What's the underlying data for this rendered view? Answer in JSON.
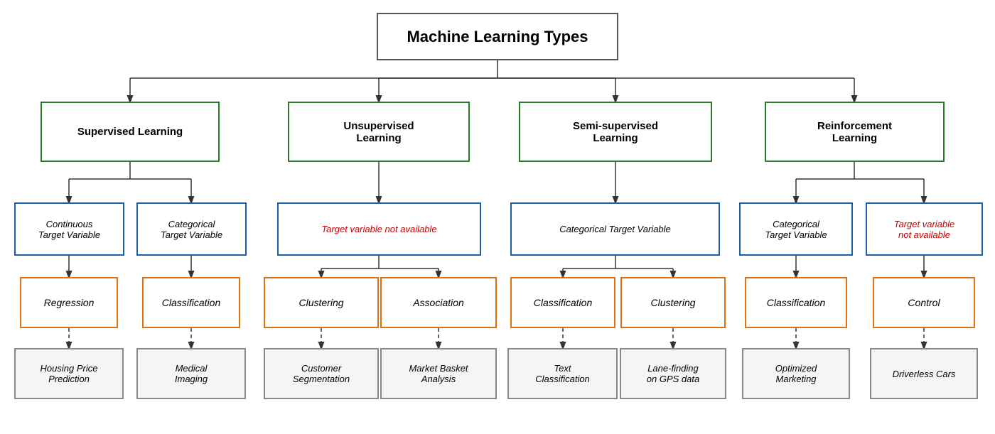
{
  "title": "Machine Learning Types",
  "nodes": {
    "root": {
      "label": "Machine Learning Types"
    },
    "supervised": {
      "label": "Supervised Learning"
    },
    "unsupervised": {
      "label": "Unsupervised\nLearning"
    },
    "semi": {
      "label": "Semi-supervised\nLearning"
    },
    "reinforcement": {
      "label": "Reinforcement\nLearning"
    },
    "continuous": {
      "label": "Continuous\nTarget Variable"
    },
    "categorical_sl": {
      "label": "Categorical\nTarget Variable"
    },
    "target_not_avail": {
      "label": "Target variable not available"
    },
    "categorical_semi": {
      "label": "Categorical Target Variable"
    },
    "categorical_rl": {
      "label": "Categorical\nTarget Variable"
    },
    "target_not_avail_rl": {
      "label": "Target variable\nnot available"
    },
    "regression": {
      "label": "Regression"
    },
    "classification_sl": {
      "label": "Classification"
    },
    "clustering_us": {
      "label": "Clustering"
    },
    "association": {
      "label": "Association"
    },
    "classification_semi": {
      "label": "Classification"
    },
    "clustering_semi": {
      "label": "Clustering"
    },
    "classification_rl": {
      "label": "Classification"
    },
    "control": {
      "label": "Control"
    },
    "housing": {
      "label": "Housing Price\nPrediction"
    },
    "medical": {
      "label": "Medical\nImaging"
    },
    "customer_seg": {
      "label": "Customer\nSegmentation"
    },
    "market_basket": {
      "label": "Market Basket\nAnalysis"
    },
    "text_class": {
      "label": "Text\nClassification"
    },
    "lane_finding": {
      "label": "Lane-finding\non GPS data"
    },
    "opt_marketing": {
      "label": "Optimized\nMarketing"
    },
    "driverless": {
      "label": "Driverless Cars"
    }
  }
}
